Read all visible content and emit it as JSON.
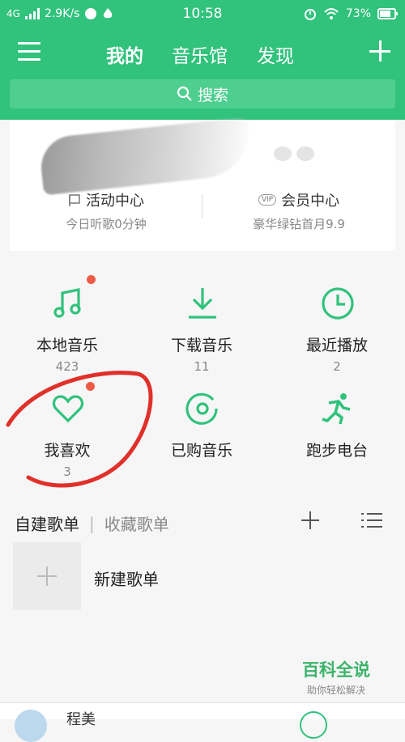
{
  "status": {
    "network": "4G",
    "speed": "2.9K/s",
    "time": "10:58",
    "battery": "73%"
  },
  "header": {
    "tabs": [
      "我的",
      "音乐馆",
      "发现"
    ],
    "active_tab": "我的"
  },
  "search": {
    "placeholder": "搜索"
  },
  "profile": {
    "activity": {
      "title": "活动中心",
      "subtitle": "今日听歌0分钟"
    },
    "vip": {
      "badge": "VIP",
      "title": "会员中心",
      "subtitle": "豪华绿钻首月9.9"
    }
  },
  "grid": [
    {
      "label": "本地音乐",
      "count": "423",
      "icon": "music-note-icon",
      "dot": true
    },
    {
      "label": "下载音乐",
      "count": "11",
      "icon": "download-icon",
      "dot": false
    },
    {
      "label": "最近播放",
      "count": "2",
      "icon": "clock-icon",
      "dot": false
    },
    {
      "label": "我喜欢",
      "count": "3",
      "icon": "heart-icon",
      "dot": true
    },
    {
      "label": "已购音乐",
      "count": "",
      "icon": "purchased-disc-icon",
      "dot": false
    },
    {
      "label": "跑步电台",
      "count": "",
      "icon": "runner-icon",
      "dot": false
    }
  ],
  "playlists": {
    "tab_created": "自建歌单",
    "separator": "|",
    "tab_collected": "收藏歌单",
    "new_label": "新建歌单"
  },
  "watermark": {
    "title": "百科全说",
    "subtitle": "助你轻松解决"
  },
  "bottom": {
    "name": "程美"
  },
  "colors": {
    "brand": "#31c27c",
    "dot": "#ee5b47",
    "annotation": "#e0302a"
  }
}
